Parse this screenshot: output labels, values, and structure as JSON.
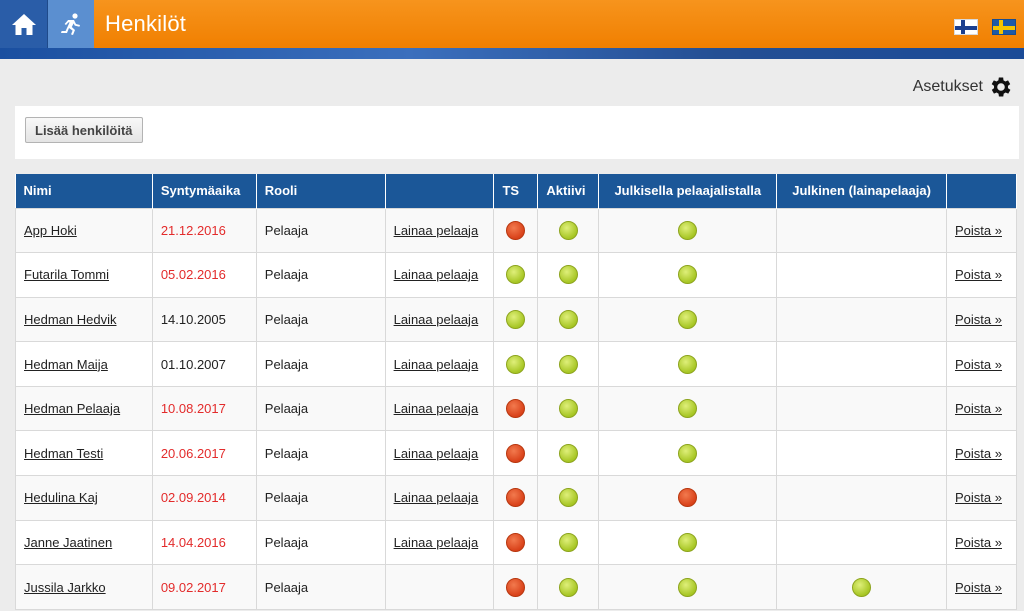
{
  "header": {
    "title": "Henkilöt",
    "icons": {
      "home": "home-icon",
      "runner": "runner-icon"
    },
    "flags": [
      "finnish-flag",
      "swedish-flag"
    ]
  },
  "settings": {
    "label": "Asetukset",
    "icon": "gear-icon"
  },
  "toolbar": {
    "add_label": "Lisää henkilöitä"
  },
  "table": {
    "columns": [
      "Nimi",
      "Syntymäaika",
      "Rooli",
      "",
      "TS",
      "Aktiivi",
      "Julkisella pelaajalistalla",
      "Julkinen (lainapelaaja)",
      ""
    ],
    "lend_label": "Lainaa pelaaja",
    "delete_label": "Poista »",
    "rows": [
      {
        "name": "App Hoki",
        "birth": "21.12.2016",
        "birth_red": true,
        "role": "Pelaaja",
        "lend": true,
        "ts": "red",
        "active": "green",
        "public": "green",
        "public_loan": ""
      },
      {
        "name": "Futarila Tommi",
        "birth": "05.02.2016",
        "birth_red": true,
        "role": "Pelaaja",
        "lend": true,
        "ts": "green",
        "active": "green",
        "public": "green",
        "public_loan": ""
      },
      {
        "name": "Hedman Hedvik",
        "birth": "14.10.2005",
        "birth_red": false,
        "role": "Pelaaja",
        "lend": true,
        "ts": "green",
        "active": "green",
        "public": "green",
        "public_loan": ""
      },
      {
        "name": "Hedman Maija",
        "birth": "01.10.2007",
        "birth_red": false,
        "role": "Pelaaja",
        "lend": true,
        "ts": "green",
        "active": "green",
        "public": "green",
        "public_loan": ""
      },
      {
        "name": "Hedman Pelaaja",
        "birth": "10.08.2017",
        "birth_red": true,
        "role": "Pelaaja",
        "lend": true,
        "ts": "red",
        "active": "green",
        "public": "green",
        "public_loan": ""
      },
      {
        "name": "Hedman Testi",
        "birth": "20.06.2017",
        "birth_red": true,
        "role": "Pelaaja",
        "lend": true,
        "ts": "red",
        "active": "green",
        "public": "green",
        "public_loan": ""
      },
      {
        "name": "Hedulina Kaj",
        "birth": "02.09.2014",
        "birth_red": true,
        "role": "Pelaaja",
        "lend": true,
        "ts": "red",
        "active": "green",
        "public": "red",
        "public_loan": ""
      },
      {
        "name": "Janne Jaatinen",
        "birth": "14.04.2016",
        "birth_red": true,
        "role": "Pelaaja",
        "lend": true,
        "ts": "red",
        "active": "green",
        "public": "green",
        "public_loan": ""
      },
      {
        "name": "Jussila Jarkko",
        "birth": "09.02.2017",
        "birth_red": true,
        "role": "Pelaaja",
        "lend": false,
        "ts": "red",
        "active": "green",
        "public": "green",
        "public_loan": "green"
      }
    ]
  },
  "colors": {
    "header_orange": "#f7941d",
    "header_blue": "#1b5798",
    "status_green": "#b5d033",
    "status_red": "#e04b1f",
    "date_red": "#e32b2b"
  }
}
